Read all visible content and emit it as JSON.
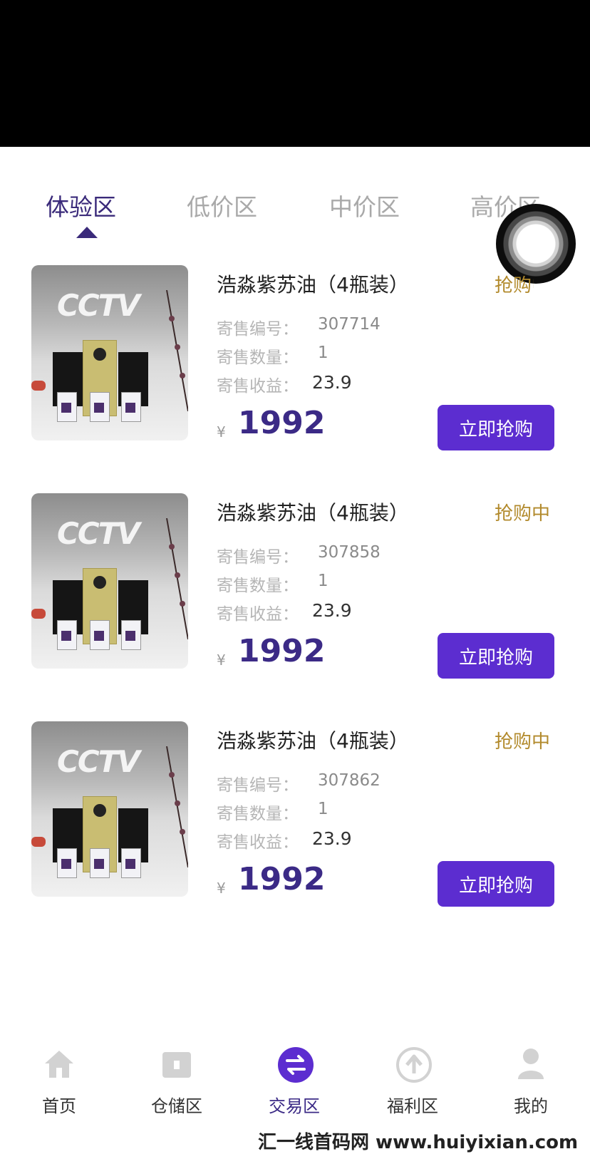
{
  "tabs": [
    {
      "label": "体验区",
      "active": true
    },
    {
      "label": "低价区",
      "active": false
    },
    {
      "label": "中价区",
      "active": false
    },
    {
      "label": "高价区",
      "active": false
    }
  ],
  "products": [
    {
      "thumb_logo": "CCTV",
      "title": "浩淼紫苏油（4瓶装）",
      "status": "抢购中",
      "fields": [
        {
          "label": "寄售编号：",
          "value": "307714"
        },
        {
          "label": "寄售数量：",
          "value": "1"
        },
        {
          "label": "寄售收益：",
          "value": "23.9"
        }
      ],
      "currency": "¥",
      "price": "1992",
      "button": "立即抢购"
    },
    {
      "thumb_logo": "CCTV",
      "title": "浩淼紫苏油（4瓶装）",
      "status": "抢购中",
      "fields": [
        {
          "label": "寄售编号：",
          "value": "307858"
        },
        {
          "label": "寄售数量：",
          "value": "1"
        },
        {
          "label": "寄售收益：",
          "value": "23.9"
        }
      ],
      "currency": "¥",
      "price": "1992",
      "button": "立即抢购"
    },
    {
      "thumb_logo": "CCTV",
      "title": "浩淼紫苏油（4瓶装）",
      "status": "抢购中",
      "fields": [
        {
          "label": "寄售编号：",
          "value": "307862"
        },
        {
          "label": "寄售数量：",
          "value": "1"
        },
        {
          "label": "寄售收益：",
          "value": "23.9"
        }
      ],
      "currency": "¥",
      "price": "1992",
      "button": "立即抢购"
    }
  ],
  "nav": [
    {
      "label": "首页",
      "icon": "home-icon"
    },
    {
      "label": "仓储区",
      "icon": "warehouse-icon"
    },
    {
      "label": "交易区",
      "icon": "exchange-icon",
      "active": true
    },
    {
      "label": "福利区",
      "icon": "upload-arrow-icon"
    },
    {
      "label": "我的",
      "icon": "person-icon"
    }
  ],
  "watermark": "汇一线首码网 www.huiyixian.com",
  "colors": {
    "accent": "#5c2dd0",
    "price": "#3b2a86",
    "status": "#b28a2c"
  }
}
